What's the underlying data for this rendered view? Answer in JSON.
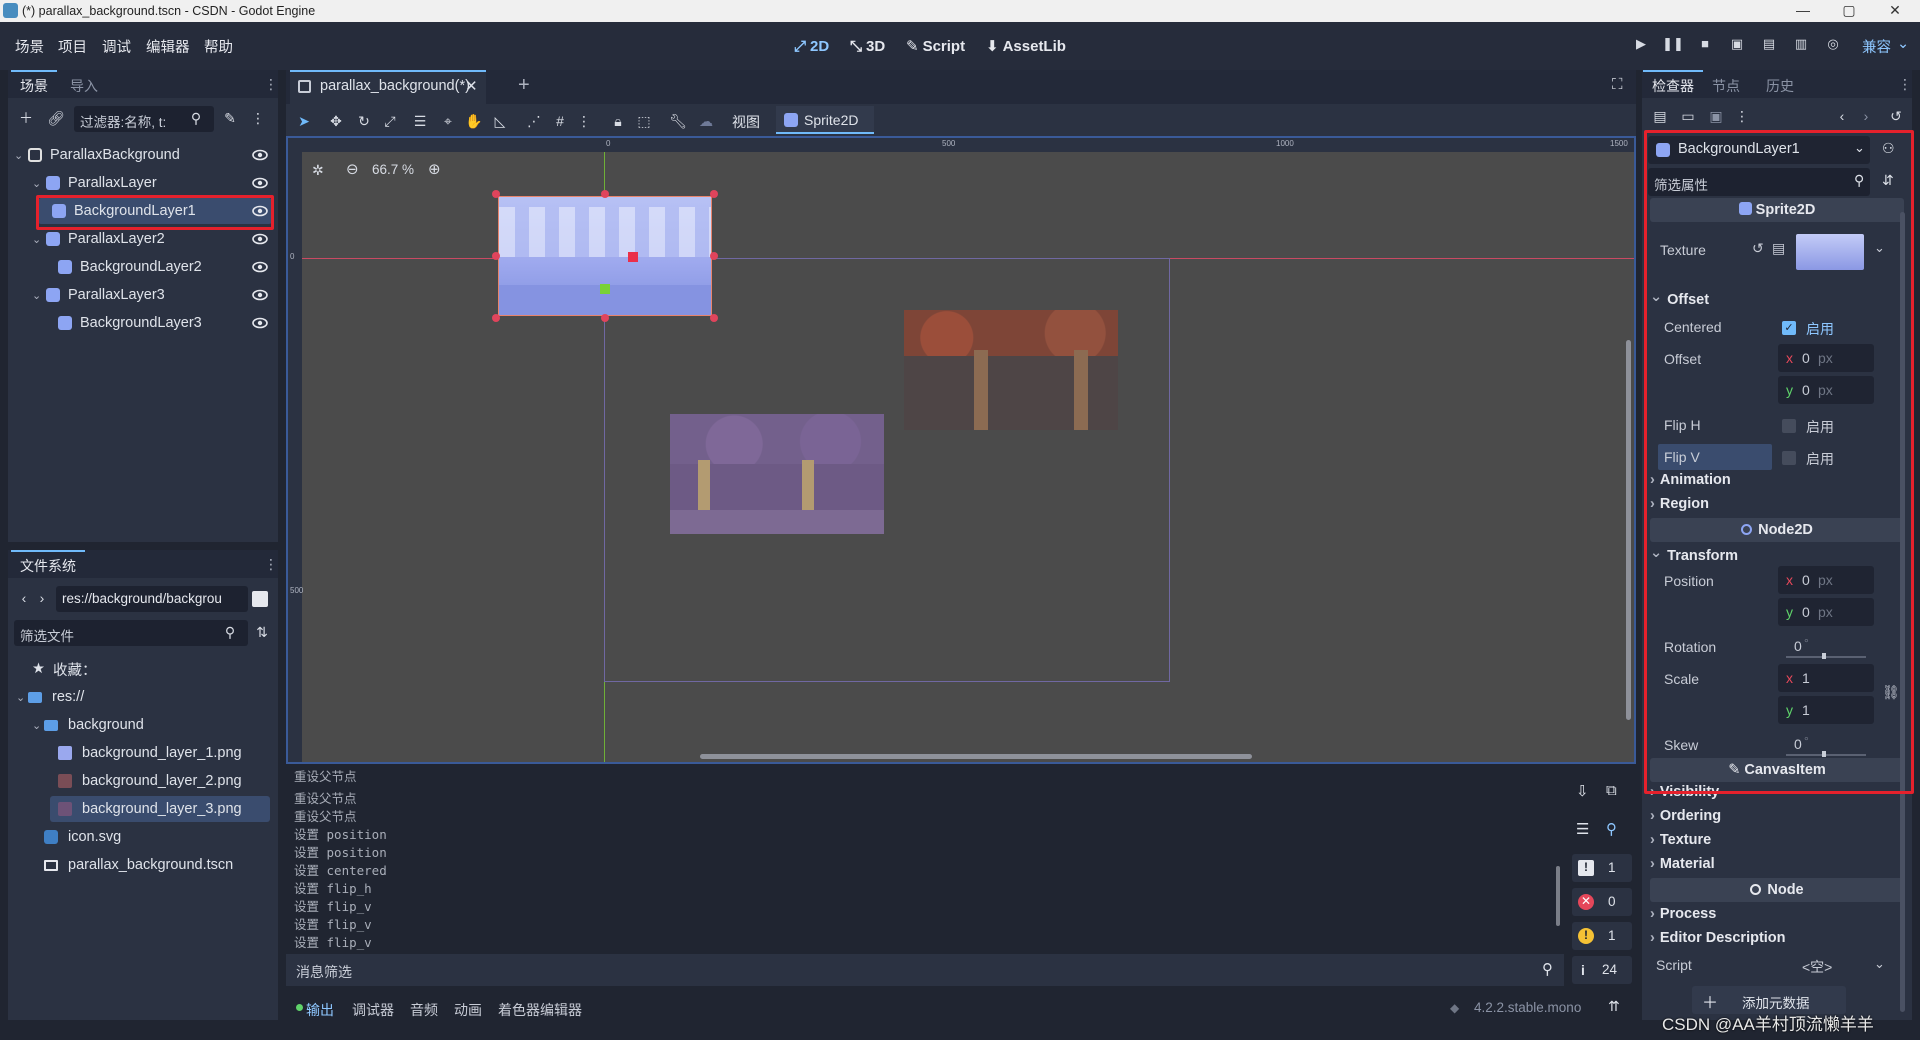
{
  "window": {
    "title": "(*) parallax_background.tscn - CSDN - Godot Engine",
    "controls": [
      "—",
      "▢",
      "✕"
    ]
  },
  "menu": {
    "items": [
      "场景",
      "项目",
      "调试",
      "编辑器",
      "帮助"
    ]
  },
  "main_buttons": {
    "b2d": "2D",
    "b3d": "3D",
    "script": "Script",
    "assetlib": "AssetLib"
  },
  "renderer": "兼容",
  "scene_dock": {
    "tabs": [
      "场景",
      "导入"
    ],
    "filter_placeholder": "过滤器:名称, t:",
    "tree": [
      {
        "label": "ParallaxBackground",
        "depth": 0,
        "type": "node",
        "selected": false
      },
      {
        "label": "ParallaxLayer",
        "depth": 1,
        "type": "node2d",
        "selected": false
      },
      {
        "label": "BackgroundLayer1",
        "depth": 2,
        "type": "sprite",
        "selected": true
      },
      {
        "label": "ParallaxLayer2",
        "depth": 1,
        "type": "node2d",
        "selected": false
      },
      {
        "label": "BackgroundLayer2",
        "depth": 2,
        "type": "sprite",
        "selected": false
      },
      {
        "label": "ParallaxLayer3",
        "depth": 1,
        "type": "node2d",
        "selected": false
      },
      {
        "label": "BackgroundLayer3",
        "depth": 2,
        "type": "sprite",
        "selected": false
      }
    ]
  },
  "filesystem_dock": {
    "title": "文件系统",
    "path": "res://background/backgrou",
    "filter_placeholder": "筛选文件",
    "items": [
      {
        "label": "收藏：",
        "depth": 0,
        "icon": "star"
      },
      {
        "label": "res://",
        "depth": 0,
        "icon": "folder"
      },
      {
        "label": "background",
        "depth": 1,
        "icon": "folder"
      },
      {
        "label": "background_layer_1.png",
        "depth": 2,
        "icon": "image"
      },
      {
        "label": "background_layer_2.png",
        "depth": 2,
        "icon": "image"
      },
      {
        "label": "background_layer_3.png",
        "depth": 2,
        "icon": "image",
        "selected": true
      },
      {
        "label": "icon.svg",
        "depth": 1,
        "icon": "svg"
      },
      {
        "label": "parallax_background.tscn",
        "depth": 1,
        "icon": "scene"
      }
    ]
  },
  "editor": {
    "tab_label": "parallax_background(*)",
    "view_menu": "视图",
    "sprite_menu": "Sprite2D",
    "zoom": "66.7 %",
    "ruler": {
      "labels_x": [
        "0",
        "500",
        "1000",
        "1500"
      ],
      "labels_y": [
        "0",
        "500"
      ]
    }
  },
  "output": {
    "lines": [
      "重设父节点",
      "重设父节点",
      "重设父节点",
      "设置 position",
      "设置 position",
      "设置 centered",
      "设置 flip_h",
      "设置 flip_v",
      "设置 flip_v",
      "设置 flip_v"
    ],
    "filter_placeholder": "消息筛选",
    "counts": {
      "messages": "1",
      "errors": "0",
      "warnings": "1",
      "info": "24"
    },
    "bottom_tabs": [
      "输出",
      "调试器",
      "音频",
      "动画",
      "着色器编辑器"
    ],
    "version": "4.2.2.stable.mono"
  },
  "inspector": {
    "tabs": [
      "检查器",
      "节点",
      "历史"
    ],
    "node_name": "BackgroundLayer1",
    "filter_placeholder": "筛选属性",
    "class_sprite": "Sprite2D",
    "texture_label": "Texture",
    "offset_section": "Offset",
    "centered": {
      "label": "Centered",
      "checked": true,
      "text": "启用"
    },
    "offset": {
      "label": "Offset",
      "x": "0",
      "y": "0",
      "unit": "px"
    },
    "flip_h": {
      "label": "Flip H",
      "checked": false,
      "text": "启用"
    },
    "flip_v": {
      "label": "Flip V",
      "checked": false,
      "text": "启用"
    },
    "animation": "Animation",
    "region": "Region",
    "class_node2d": "Node2D",
    "transform": "Transform",
    "position": {
      "label": "Position",
      "x": "0",
      "y": "0",
      "unit": "px"
    },
    "rotation": {
      "label": "Rotation",
      "value": "0",
      "unit": "°"
    },
    "scale": {
      "label": "Scale",
      "x": "1",
      "y": "1"
    },
    "skew": {
      "label": "Skew",
      "value": "0",
      "unit": "°"
    },
    "class_canvasitem": "CanvasItem",
    "canvas_sections": [
      "Visibility",
      "Ordering",
      "Texture",
      "Material"
    ],
    "class_node": "Node",
    "node_sections": [
      "Process",
      "Editor Description"
    ],
    "script_label": "Script",
    "script_value": "<空>",
    "add_metadata": "添加元数据",
    "axis_x": "x",
    "axis_y": "y"
  },
  "watermark": "CSDN @AA羊村顶流懒羊羊",
  "colors": {
    "accent": "#70bafa",
    "highlight": "#e5212c",
    "bg": "#202531",
    "panel": "#2b3242"
  }
}
